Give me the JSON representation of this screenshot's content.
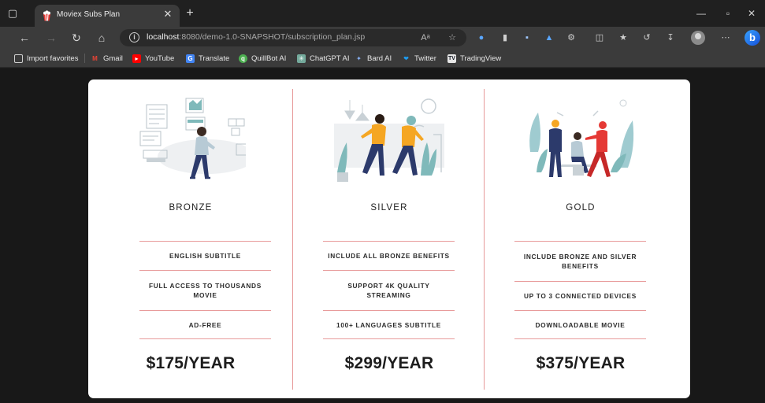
{
  "browser": {
    "tab": {
      "title": "Moviex Subs Plan"
    },
    "address": {
      "host": "localhost",
      "path": ":8080/demo-1.0-SNAPSHOT/subscription_plan.jsp",
      "read_aloud": "Aᵃ"
    },
    "bookmarks": [
      {
        "label": "Import favorites",
        "icon": "import-icon",
        "color": "#cfcfcf"
      },
      {
        "label": "Gmail",
        "icon": "gmail-icon",
        "color": "#ea4335"
      },
      {
        "label": "YouTube",
        "icon": "youtube-icon",
        "color": "#ff0000"
      },
      {
        "label": "Translate",
        "icon": "translate-icon",
        "color": "#4285f4"
      },
      {
        "label": "QuillBot AI",
        "icon": "quillbot-icon",
        "color": "#4caf50"
      },
      {
        "label": "ChatGPT AI",
        "icon": "chatgpt-icon",
        "color": "#74aa9c"
      },
      {
        "label": "Bard AI",
        "icon": "bard-icon",
        "color": "#8ab4f8"
      },
      {
        "label": "Twitter",
        "icon": "twitter-icon",
        "color": "#1d9bf0"
      },
      {
        "label": "TradingView",
        "icon": "tradingview-icon",
        "color": "#131722"
      }
    ]
  },
  "plans": [
    {
      "name": "BRONZE",
      "features": [
        "ENGLISH SUBTITLE",
        "FULL ACCESS TO THOUSANDS MOVIE",
        "AD-FREE"
      ],
      "price": "$175/YEAR",
      "illustration": "person-dashboard-illustration"
    },
    {
      "name": "SILVER",
      "features": [
        "INCLUDE ALL BRONZE BENEFITS",
        "SUPPORT 4K QUALITY STREAMING",
        "100+ LANGUAGES SUBTITLE"
      ],
      "price": "$299/YEAR",
      "illustration": "two-people-walking-illustration"
    },
    {
      "name": "GOLD",
      "features": [
        "INCLUDE BRONZE AND SILVER BENEFITS",
        "UP TO 3 CONNECTED DEVICES",
        "DOWNLOADABLE MOVIE"
      ],
      "price": "$375/YEAR",
      "illustration": "team-meeting-illustration"
    }
  ],
  "colors": {
    "accent_divider": "#e79999",
    "page_bg": "#181818",
    "card_bg": "#ffffff",
    "people_orange": "#f5a623",
    "people_navy": "#2c3a6b"
  }
}
